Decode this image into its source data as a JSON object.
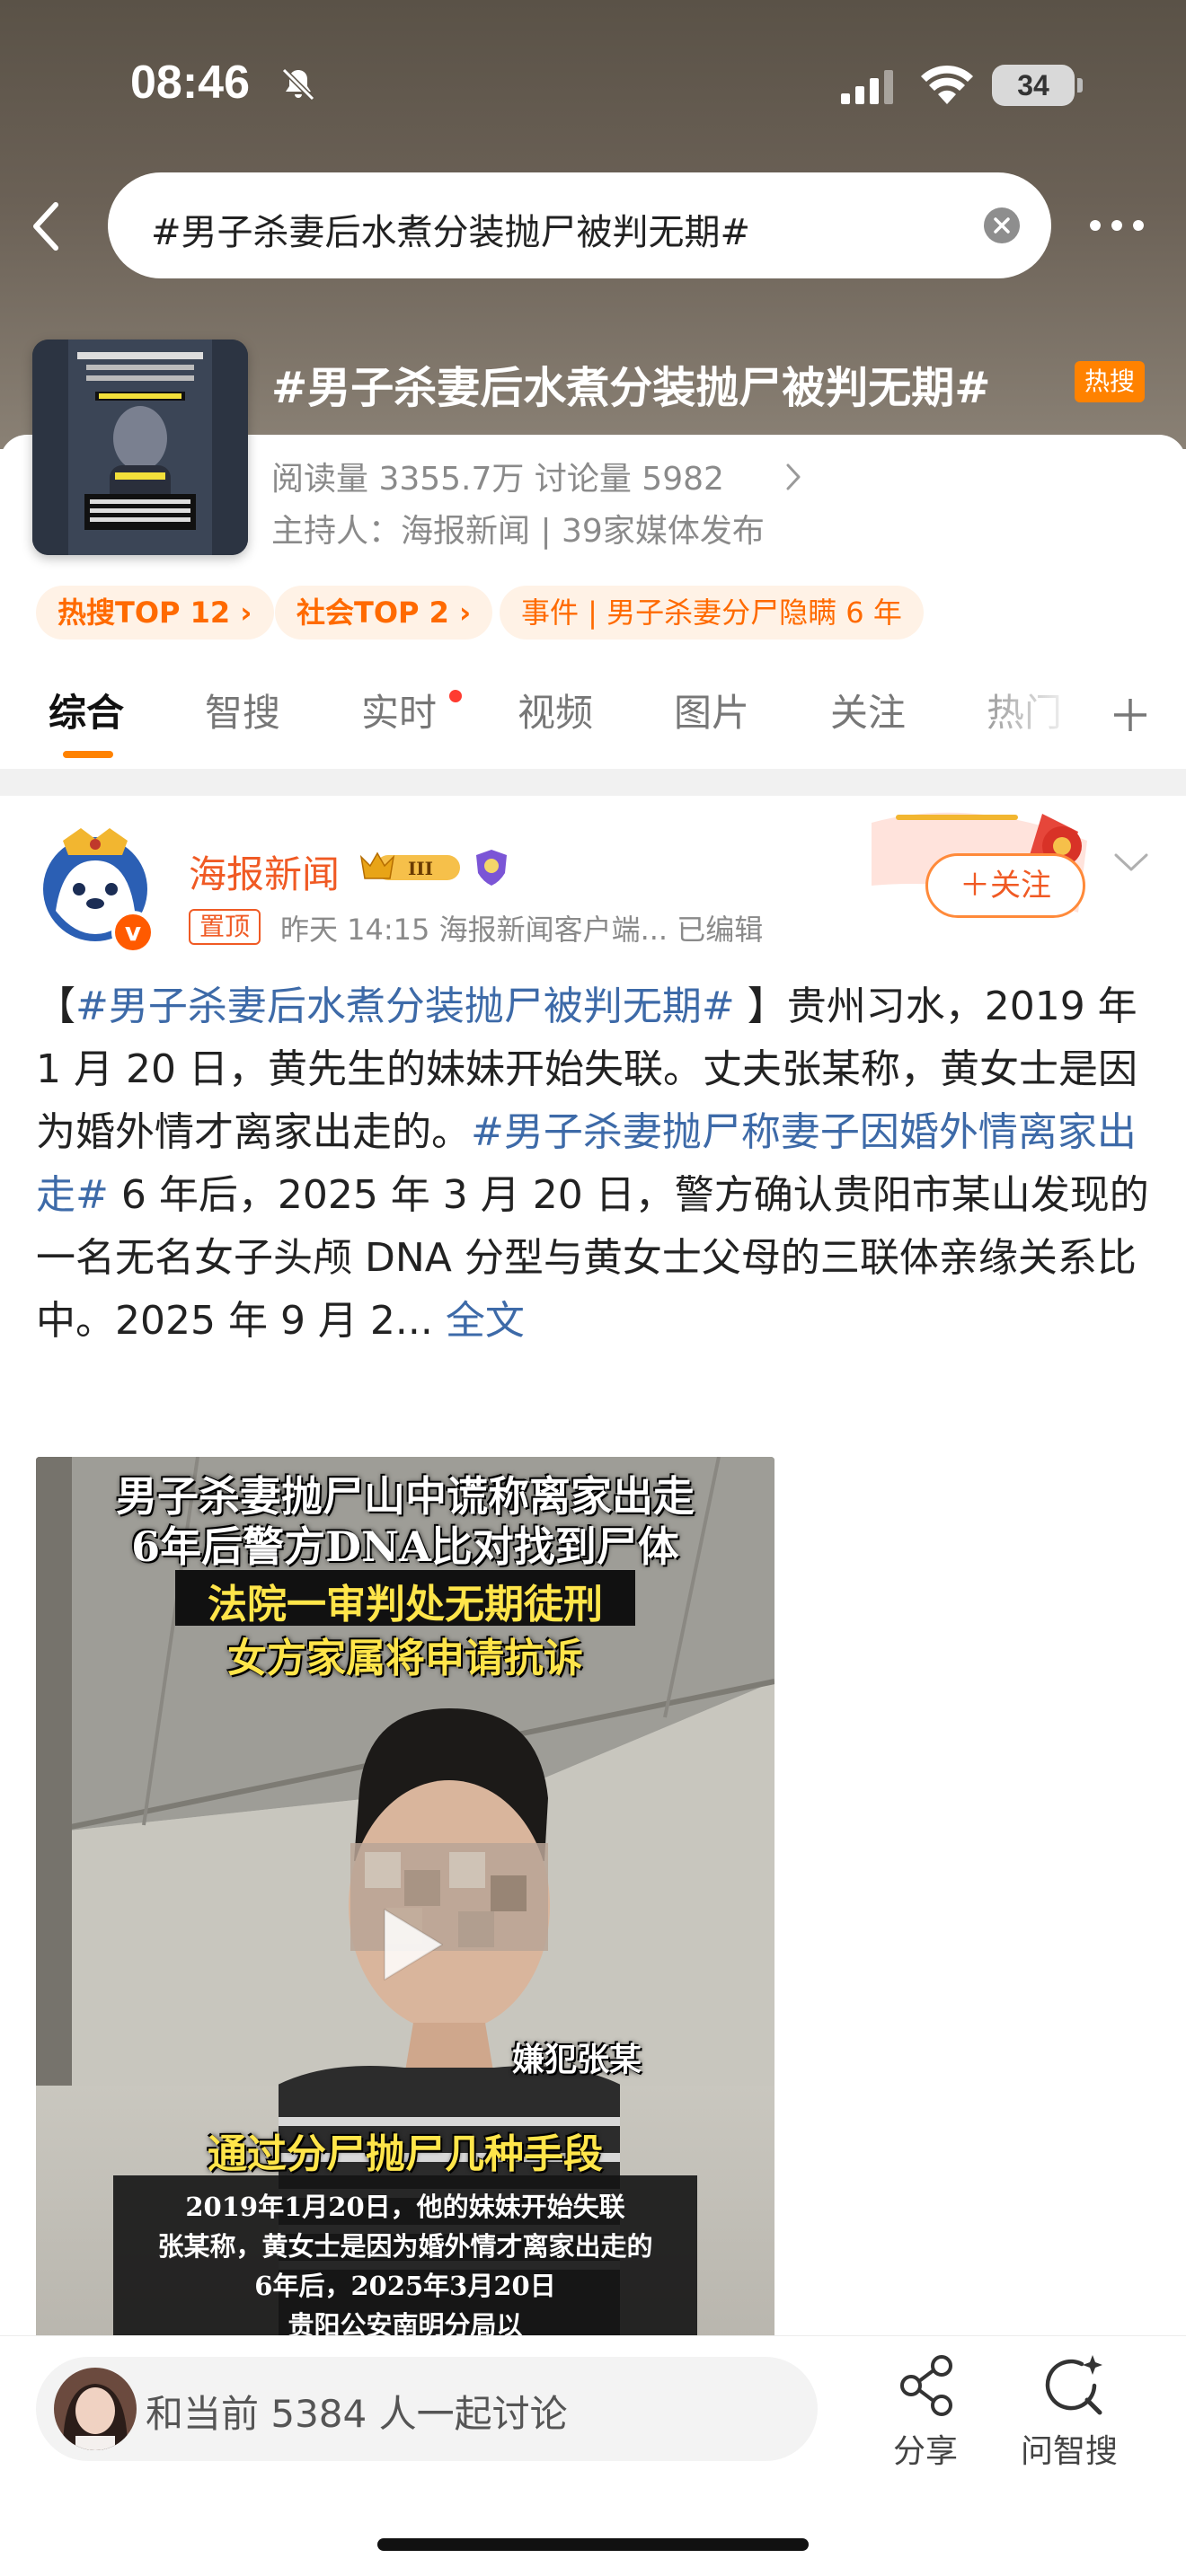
{
  "status_bar": {
    "time": "08:46",
    "battery": "34"
  },
  "search": {
    "query": "#男子杀妻后水煮分装抛尸被判无期#"
  },
  "topic": {
    "title": "#男子杀妻后水煮分装抛尸被判无期#",
    "hot_badge": "热搜",
    "stats": "阅读量 3355.7万  讨论量 5982",
    "host": "主持人：海报新闻 | 39家媒体发布",
    "tags": [
      {
        "label": "热搜TOP 12 ›"
      },
      {
        "label": "社会TOP 2 ›"
      },
      {
        "label": "事件 | 男子杀妻分尸隐瞒 6 年"
      }
    ]
  },
  "tabs": [
    {
      "label": "综合"
    },
    {
      "label": "智搜"
    },
    {
      "label": "实时"
    },
    {
      "label": "视频"
    },
    {
      "label": "图片"
    },
    {
      "label": "关注"
    },
    {
      "label": "热门"
    }
  ],
  "post": {
    "author": "海报新闻",
    "vip_level": "III",
    "verified_mark": "v",
    "pin_tag": "置顶",
    "meta": "昨天 14:15   海报新闻客户端...   已编辑",
    "follow_label": "＋关注",
    "text": {
      "open": "【",
      "tag1": "#男子杀妻后水煮分装抛尸被判无期#",
      "p1": " 】贵州习水，2019 年 1 月 20 日，黄先生的妹妹开始失联。丈夫张某称，黄女士是因为婚外情才离家出走的。",
      "tag2": "#男子杀妻抛尸称妻子因婚外情离家出走#",
      "p2": " 6 年后，2025 年 3 月 20 日，警方确认贵阳市某山发现的一名无名女子头颅 DNA 分型与黄女士父母的三联体亲缘关系比中。2025 年 9 月 2...",
      "more": "全文"
    },
    "video": {
      "caption1": "男子杀妻抛尸山中谎称离家出走",
      "caption2": "6年后警方DNA比对找到尸体",
      "caption3": "法院一审判处无期徒刑",
      "caption4": "女方家属将申请抗诉",
      "suspect_label": "嫌犯张某",
      "caption5": "通过分尸抛尸几种手段",
      "subtitles": [
        "2019年1月20日，他的妹妹开始失联",
        "张某称，黄女士是因为婚外情才离家出走的",
        "6年后，2025年3月20日",
        "贵阳公安南明分局以"
      ]
    }
  },
  "bottom_bar": {
    "discuss_text": "和当前 5384 人一起讨论",
    "share_label": "分享",
    "ai_search_label": "问智搜"
  }
}
